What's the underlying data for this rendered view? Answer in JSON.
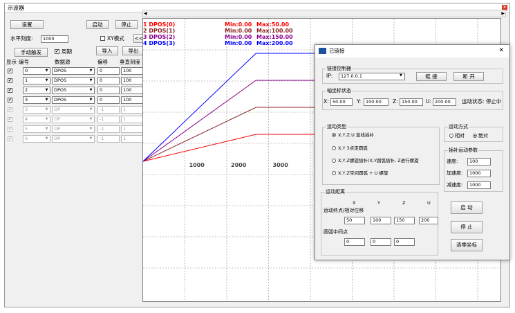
{
  "window": {
    "title": "示波器"
  },
  "left": {
    "settings_btn": "设置",
    "start_btn": "启动",
    "stop_btn": "停止",
    "hscale_label": "水平刻度:",
    "hscale_value": "1000",
    "xy_mode_label": "XY模式",
    "collapse_btn": "<<",
    "manual_trigger_btn": "手动触发",
    "cycle_label": "周期",
    "import_btn": "导入",
    "export_btn": "导出",
    "headers": [
      "显示",
      "编号",
      "数据源",
      "偏移",
      "垂直刻度"
    ],
    "rows": [
      {
        "show": "✔",
        "num": "0",
        "source": "DPOS",
        "offset": "0",
        "scale": "100",
        "enabled": true
      },
      {
        "show": "✔",
        "num": "1",
        "source": "DPOS",
        "offset": "0",
        "scale": "100",
        "enabled": true
      },
      {
        "show": "✔",
        "num": "2",
        "source": "DPOS",
        "offset": "0",
        "scale": "100",
        "enabled": true
      },
      {
        "show": "✔",
        "num": "3",
        "source": "DPOS",
        "offset": "0",
        "scale": "100",
        "enabled": true
      },
      {
        "show": "✔",
        "num": "3",
        "source": "OP",
        "offset": "-1",
        "scale": "1",
        "enabled": false
      },
      {
        "show": "✔",
        "num": "4",
        "source": "OP",
        "offset": "-1",
        "scale": "1",
        "enabled": false
      },
      {
        "show": "✔",
        "num": "5",
        "source": "OP",
        "offset": "-1",
        "scale": "1",
        "enabled": false
      },
      {
        "show": "✔",
        "num": "6",
        "source": "OP",
        "offset": "-1",
        "scale": "1",
        "enabled": false
      }
    ]
  },
  "chart_data": {
    "type": "line",
    "x_ticks": [
      "1000",
      "2000",
      "3000"
    ],
    "series": [
      {
        "label": "1 DPOS(0)",
        "min": "Min:0.00",
        "max": "Max:50.00",
        "color": "#ff0000",
        "points": [
          [
            0,
            0
          ],
          [
            2700,
            50
          ],
          [
            9500,
            50
          ]
        ]
      },
      {
        "label": "2 DPOS(1)",
        "min": "Min:0.00",
        "max": "Max:100.00",
        "color": "#8b2323",
        "points": [
          [
            0,
            0
          ],
          [
            2700,
            100
          ],
          [
            9500,
            100
          ]
        ]
      },
      {
        "label": "3 DPOS(2)",
        "min": "Min:0.00",
        "max": "Max:150.00",
        "color": "#8b008b",
        "points": [
          [
            0,
            0
          ],
          [
            2700,
            150
          ],
          [
            9500,
            150
          ]
        ]
      },
      {
        "label": "4 DPOS(3)",
        "min": "Min:0.00",
        "max": "Max:200.00",
        "color": "#0000ff",
        "points": [
          [
            0,
            0
          ],
          [
            2700,
            200
          ],
          [
            9500,
            200
          ]
        ]
      }
    ]
  },
  "dialog": {
    "title": "已链接",
    "close_glyph": "✕",
    "conn_group": "链接控制器",
    "ip_label": "IP:",
    "ip_value": "127.0.0.1",
    "connect_btn": "链 接",
    "disconnect_btn": "断 开",
    "axis_group": "轴坐标状态",
    "x_label": "X:",
    "x_value": "50.00",
    "y_label": "Y:",
    "y_value": "100.00",
    "z_label": "Z:",
    "z_value": "150.00",
    "u_label": "U:",
    "u_value": "200.00",
    "motion_status": "运动状态: 停止中",
    "type_group": "运动类型",
    "type_opts": [
      "X,Y,Z,U  直线插补",
      "X,Y 3点定圆弧",
      "X,Y,Z螺旋插补(X,Y圆弧插补, Z进行螺旋",
      "X,Y,Z空间圆弧 + U 螺旋"
    ],
    "mode_group": "运动方式",
    "mode_rel": "相对",
    "mode_abs": "绝对",
    "param_group": "插补运动参数",
    "speed_label": "速度:",
    "speed_value": "100",
    "accel_label": "加速度:",
    "accel_value": "1000",
    "decel_label": "减速度:",
    "decel_value": "1000",
    "dist_group": "运动距离",
    "axis_names": [
      "X",
      "Y",
      "Z",
      "U"
    ],
    "end_label": "运动终点/相对位移",
    "end_values": [
      "50",
      "100",
      "150",
      "200"
    ],
    "mid_label": "圆弧中间点",
    "mid_values": [
      "0",
      "0",
      "0"
    ],
    "start_btn": "启 动",
    "stop_btn": "停 止",
    "clear_btn": "清零坐标"
  }
}
